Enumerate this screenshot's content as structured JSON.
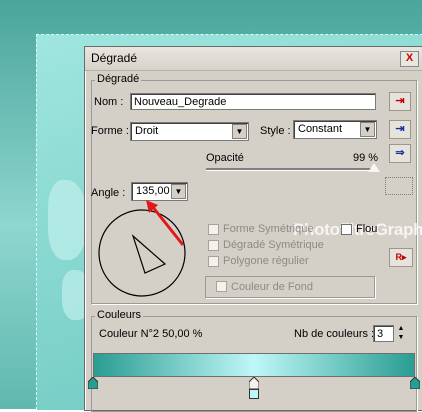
{
  "window": {
    "title": "Dégradé",
    "close_label": "X"
  },
  "degrade": {
    "legend": "Dégradé",
    "nom_label": "Nom :",
    "nom_value": "Nouveau_Degrade",
    "forme_label": "Forme :",
    "forme_value": "Droit",
    "style_label": "Style :",
    "style_value": "Constant",
    "opacite_label": "Opacité",
    "opacite_value": "99 %",
    "opacite_fraction": 0.99,
    "angle_label": "Angle :",
    "angle_value": "135,00",
    "options": [
      {
        "label": "Forme Symétrique",
        "checked": false,
        "enabled": false
      },
      {
        "label": "Dégradé Symétrique",
        "checked": false,
        "enabled": false
      },
      {
        "label": "Polygone régulier",
        "checked": false,
        "enabled": false
      }
    ],
    "flou_label": "Flou",
    "couleur_de_fond_label": "Couleur de Fond"
  },
  "couleurs": {
    "legend": "Couleurs",
    "status": "Couleur N°2 50,00 %",
    "nb_label": "Nb de couleurs :",
    "nb_value": "3",
    "stops": [
      "#2a9d92",
      "#bff7f7",
      "#2a9d92"
    ]
  },
  "watermark": "PhotofiltreGraphic",
  "icons": {
    "nom_btn": "save-gradient-icon",
    "row2_btn": "save-icon",
    "row3_btn": "load-icon",
    "reset_btn": "reset-icon"
  },
  "colors": {
    "arrow": "#e21818",
    "accent_blue": "#1b2f9c"
  }
}
